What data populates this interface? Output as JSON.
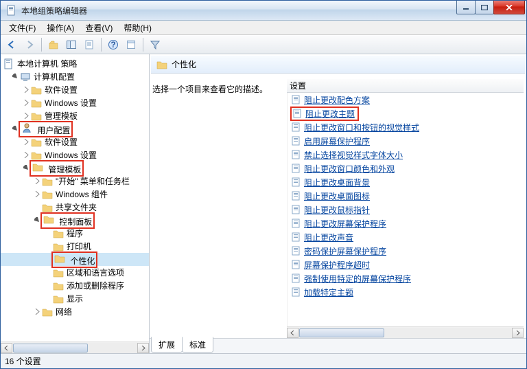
{
  "window": {
    "title": "本地组策略编辑器"
  },
  "menu": {
    "file": "文件(F)",
    "action": "操作(A)",
    "view": "查看(V)",
    "help": "帮助(H)"
  },
  "tree": {
    "root": "本地计算机 策略",
    "computer_config": "计算机配置",
    "cc_software": "软件设置",
    "cc_windows": "Windows 设置",
    "cc_admin": "管理模板",
    "user_config": "用户配置",
    "uc_software": "软件设置",
    "uc_windows": "Windows 设置",
    "admin_templates": "管理模板",
    "start_menu": "\"开始\" 菜单和任务栏",
    "win_components": "Windows 组件",
    "shared_folders": "共享文件夹",
    "control_panel": "控制面板",
    "programs": "程序",
    "printers": "打印机",
    "personalization": "个性化",
    "region_lang": "区域和语言选项",
    "add_remove": "添加或删除程序",
    "display": "显示",
    "network": "网络"
  },
  "right": {
    "header": "个性化",
    "desc_prompt": "选择一个项目来查看它的描述。",
    "settings_header": "设置",
    "settings": [
      "阻止更改配色方案",
      "阻止更改主题",
      "阻止更改窗口和按钮的视觉样式",
      "启用屏幕保护程序",
      "禁止选择视觉样式字体大小",
      "阻止更改窗口颜色和外观",
      "阻止更改桌面背景",
      "阻止更改桌面图标",
      "阻止更改鼠标指针",
      "阻止更改屏幕保护程序",
      "阻止更改声音",
      "密码保护屏幕保护程序",
      "屏幕保护程序超时",
      "强制使用特定的屏幕保护程序",
      "加载特定主题"
    ],
    "highlight_index": 1,
    "tab_ext": "扩展",
    "tab_std": "标准"
  },
  "status": {
    "count": "16 个设置"
  }
}
